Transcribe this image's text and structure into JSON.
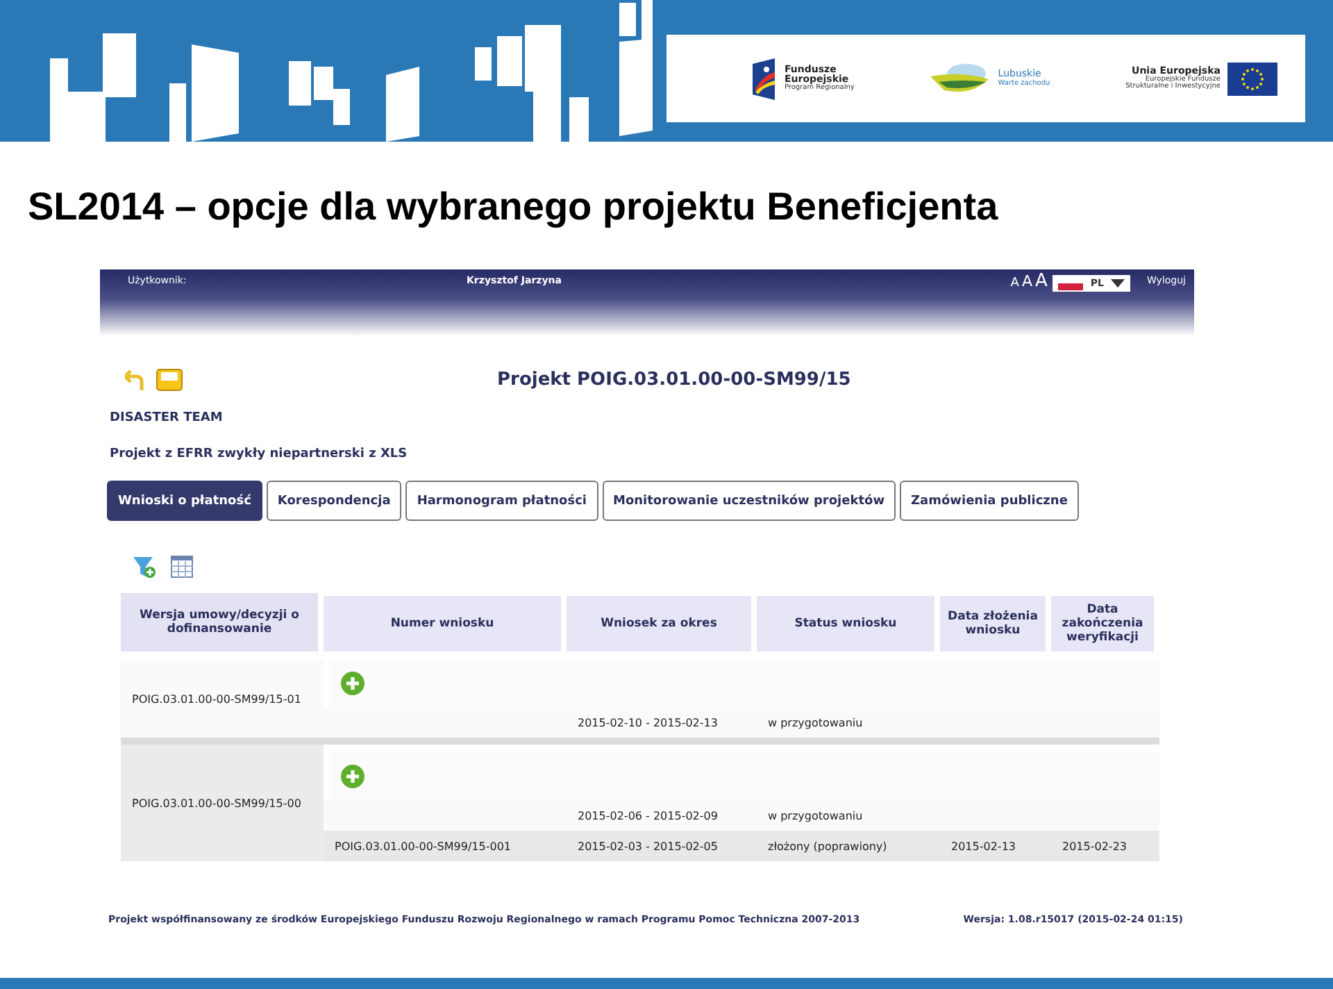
{
  "banner": {
    "logos": [
      {
        "kind": "funds",
        "lines": [
          "Fundusze",
          "Europejskie",
          "Program Regionalny"
        ]
      },
      {
        "kind": "region",
        "lines": [
          "Lubuskie",
          "Warte zachodu"
        ]
      },
      {
        "kind": "eu",
        "lines": [
          "Unia Europejska",
          "Europejskie Fundusze",
          "Strukturalne i Inwestycyjne"
        ]
      }
    ]
  },
  "slide_title": "SL2014 – opcje dla wybranego projektu Beneficjenta",
  "app": {
    "header": {
      "user_label": "Użytkownik:",
      "user_name": "Krzysztof Jarzyna",
      "font_sizes": [
        "A",
        "A",
        "A"
      ],
      "language": "PL",
      "logout": "Wyloguj"
    },
    "project_title": "Projekt POIG.03.01.00-00-SM99/15",
    "team": "DISASTER TEAM",
    "project_type": "Projekt z EFRR zwykły niepartnerski z XLS",
    "tabs": [
      {
        "label": "Wnioski o płatność",
        "selected": true
      },
      {
        "label": "Korespondencja",
        "selected": false
      },
      {
        "label": "Harmonogram płatności",
        "selected": false
      },
      {
        "label": "Monitorowanie uczestników projektów",
        "selected": false
      },
      {
        "label": "Zamówienia publiczne",
        "selected": false
      }
    ],
    "table": {
      "columns": [
        "Wersja umowy/decyzji o dofinansowanie",
        "Numer wniosku",
        "Wniosek za okres",
        "Status wniosku",
        "Data złożenia wniosku",
        "Data zakończenia weryfikacji"
      ],
      "groups": [
        {
          "version": "POIG.03.01.00-00-SM99/15-01",
          "rows": [
            {
              "kind": "add"
            },
            {
              "kind": "data",
              "cells": [
                "",
                "2015-02-10 - 2015-02-13",
                "w przygotowaniu",
                "",
                ""
              ]
            }
          ]
        },
        {
          "version": "POIG.03.01.00-00-SM99/15-00",
          "rows": [
            {
              "kind": "add"
            },
            {
              "kind": "data",
              "cells": [
                "",
                "2015-02-06 - 2015-02-09",
                "w przygotowaniu",
                "",
                ""
              ]
            },
            {
              "kind": "data",
              "cells": [
                "POIG.03.01.00-00-SM99/15-001",
                "2015-02-03 - 2015-02-05",
                "złożony (poprawiony)",
                "2015-02-13",
                "2015-02-23"
              ]
            }
          ]
        }
      ]
    }
  },
  "footer": {
    "note": "Projekt współfinansowany ze środków Europejskiego Funduszu Rozwoju Regionalnego w ramach Programu Pomoc Techniczna 2007-2013",
    "version": "Wersja: 1.08.r15017 (2015-02-24 01:15)"
  }
}
